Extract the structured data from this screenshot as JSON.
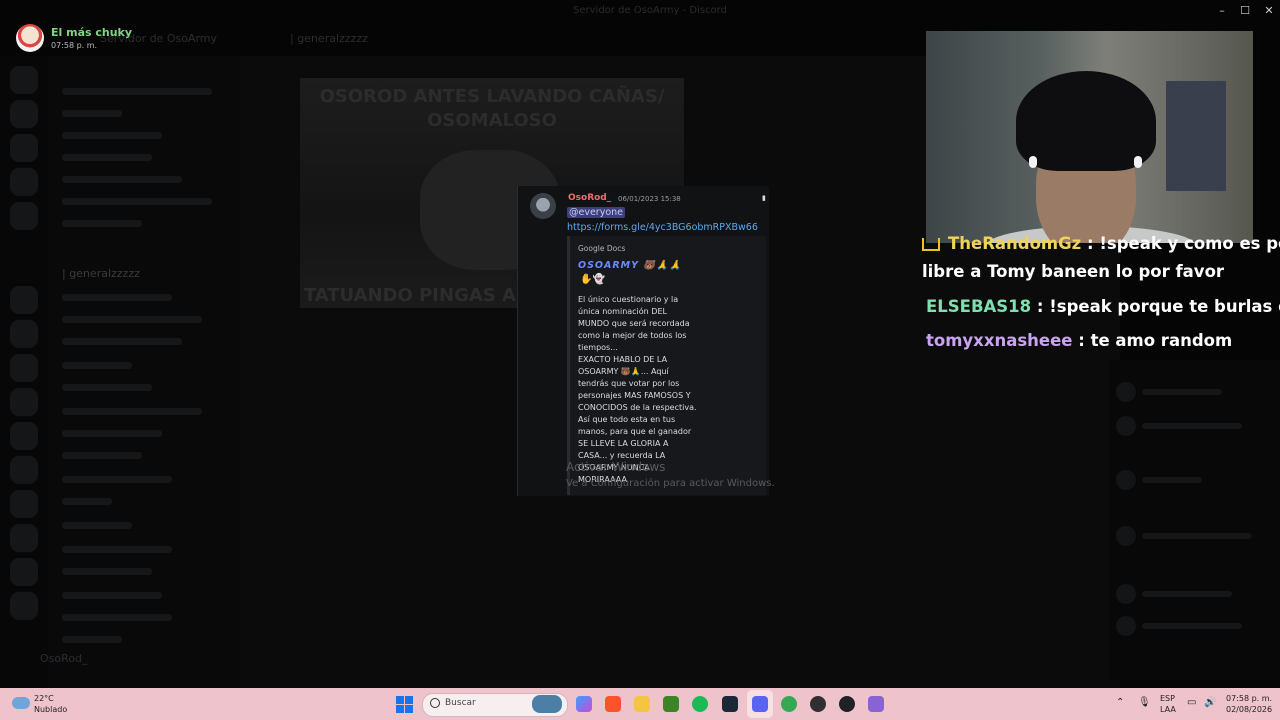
{
  "window": {
    "title": "Servidor de OsoArmy - Discord"
  },
  "user_badge": {
    "name": "El más chuky",
    "time": "07:58 p. m."
  },
  "background": {
    "server_name": "Servidor de OsoArmy",
    "channel_header": "| generalzzzzz",
    "meme_top_text": "OSOROD ANTES LAVANDO CAÑAS/ OSOMALOSO",
    "meme_bottom_text": "TATUANDO PINGAS A V",
    "channel_item": "| generalzzzzz",
    "user_footer": "OsoRod_"
  },
  "message": {
    "author": "OsoRod_",
    "date": "06/01/2023 15:38",
    "mention": "@everyone",
    "link": "https://forms.gle/4yc3BG6obmRPXBw66",
    "embed": {
      "provider": "Google Docs",
      "title": "OSOARMY",
      "emojis": "🐻🙏🙏",
      "emojis2": "✋👻",
      "description": "El único cuestionario y la única nominación DEL MUNDO que será recordada como la mejor de todos los tiempos...\nEXACTO HABLO DE LA OSOARMY 🐻🙏... Aquí tendrás que votar por los personajes MAS FAMOSOS Y CONOCIDOS de la respectiva. Así que todo esta en tus manos, para que el ganador SE LLEVE LA GLORIA A CASA... y recuerda LA OSOARMY NUNCA MORIRAAAA"
    }
  },
  "watermark": {
    "line1": "Activar Windows",
    "line2": "Ve a Configuración para activar Windows."
  },
  "chat": [
    {
      "user": "TheRandomGz",
      "color": "#f0d35a",
      "text": ": !speak y como es posi",
      "continuation": "libre a Tomy baneen lo por favor"
    },
    {
      "user": "ELSEBAS18",
      "color": "#7ee0b0",
      "text": ": !speak porque te burlas de p"
    },
    {
      "user": "tomyxxnasheee",
      "color": "#c9a3f0",
      "text": ": te amo random"
    }
  ],
  "taskbar": {
    "weather_temp": "22°C",
    "weather_desc": "Nublado",
    "search_placeholder": "Buscar",
    "lang_top": "ESP",
    "lang_bottom": "LAA",
    "time": "07:58 p. m.",
    "date": "02/08/2026"
  }
}
